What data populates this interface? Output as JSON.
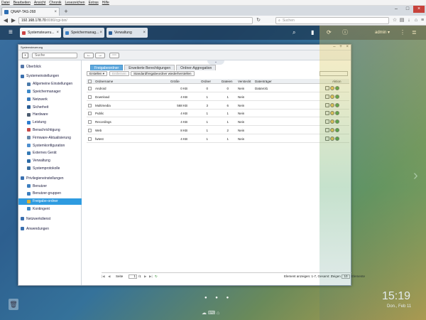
{
  "browser": {
    "menu": [
      "Datei",
      "Bearbeiten",
      "Ansicht",
      "Chronik",
      "Lesezeichen",
      "Extras",
      "Hilfe"
    ],
    "tab_title": "QNAP-TAS-268",
    "url_host": "192.168.178.70",
    "url_rest": ":8080/cgi-bin/",
    "search_placeholder": "Suchen"
  },
  "qnap": {
    "tabs": [
      "Systemsteueru...",
      "Speichermanag...",
      "Verwaltung"
    ],
    "user": "admin",
    "clock": "15:19",
    "date": "Don., Feb 11"
  },
  "window": {
    "title": "Systemsteuerung",
    "search_placeholder": "Suche"
  },
  "sidebar": [
    {
      "label": "Überblick",
      "level": "top",
      "color": "#5577aa"
    },
    {
      "label": "Systemeinstellungen",
      "level": "top",
      "color": "#3a70b0"
    },
    {
      "label": "Allgemeine Einstellungen",
      "level": "sub",
      "color": "#4a7aaa"
    },
    {
      "label": "Speichermanager",
      "level": "sub",
      "color": "#3f8ac9"
    },
    {
      "label": "Netzwerk",
      "level": "sub",
      "color": "#3b7bbb"
    },
    {
      "label": "Sicherheit",
      "level": "sub",
      "color": "#2c5e95"
    },
    {
      "label": "Hardware",
      "level": "sub",
      "color": "#4c5c70"
    },
    {
      "label": "Leistung",
      "level": "sub",
      "color": "#2e7ccf"
    },
    {
      "label": "Benachrichtigung",
      "level": "sub",
      "color": "#c64a4a"
    },
    {
      "label": "Firmware-Aktualisierung",
      "level": "sub",
      "color": "#6688aa"
    },
    {
      "label": "Systemkonfiguration",
      "level": "sub",
      "color": "#4f8fcf"
    },
    {
      "label": "Externes Gerät",
      "level": "sub",
      "color": "#357ab5"
    },
    {
      "label": "Verwaltung",
      "level": "sub",
      "color": "#2d6aa5"
    },
    {
      "label": "Systemprotokolle",
      "level": "sub",
      "color": "#3c6e9e"
    },
    {
      "label": "Privilegieneinstellungen",
      "level": "top",
      "color": "#3a70b0"
    },
    {
      "label": "Benutzer",
      "level": "sub",
      "color": "#3d7fbf"
    },
    {
      "label": "Benutzer-gruppen",
      "level": "sub",
      "color": "#3d7fbf"
    },
    {
      "label": "Freigabe-ordner",
      "level": "sub",
      "color": "#e0b030",
      "active": true
    },
    {
      "label": "Kontingent",
      "level": "sub",
      "color": "#3f8ac9"
    },
    {
      "label": "Netzwerkdienst",
      "level": "top",
      "color": "#3a70b0"
    },
    {
      "label": "Anwendungen",
      "level": "top",
      "color": "#3a70b0"
    }
  ],
  "tabs": [
    "Freigabeordner",
    "Erweiterte Berechtigungen",
    "Ordner-Aggregation"
  ],
  "toolbar": {
    "create": "Erstellen",
    "remove": "Entfernen",
    "restore": "Standardfreigabeordner wiederherstellen"
  },
  "columns": {
    "name": "Ordnername",
    "size": "Größe",
    "folders": "Ordner",
    "files": "Dateien",
    "hidden": "Versteckt",
    "volume": "Datenträger",
    "action": "Aktion"
  },
  "rows": [
    {
      "name": "Android",
      "size": "0 KB",
      "folders": "0",
      "files": "0",
      "hidden": "Nein",
      "volume": "DataVol1"
    },
    {
      "name": "Download",
      "size": "4 KB",
      "folders": "1",
      "files": "1",
      "hidden": "Nein",
      "volume": ""
    },
    {
      "name": "Multimedia",
      "size": "568 KB",
      "folders": "3",
      "files": "6",
      "hidden": "Nein",
      "volume": ""
    },
    {
      "name": "Public",
      "size": "4 KB",
      "folders": "1",
      "files": "1",
      "hidden": "Nein",
      "volume": ""
    },
    {
      "name": "Recordings",
      "size": "4 KB",
      "folders": "1",
      "files": "1",
      "hidden": "Nein",
      "volume": ""
    },
    {
      "name": "Web",
      "size": "8 KB",
      "folders": "1",
      "files": "2",
      "hidden": "Nein",
      "volume": ""
    },
    {
      "name": "fwtest",
      "size": "4 KB",
      "folders": "1",
      "files": "1",
      "hidden": "Nein",
      "volume": ""
    }
  ],
  "footer": {
    "page_label": "Seite",
    "page": "1",
    "of": "/1",
    "summary": "Element anzeigen: 1-7, Gesamt: 7",
    "show": "Zeigen",
    "per_page": "10",
    "elements": "Elemente"
  }
}
